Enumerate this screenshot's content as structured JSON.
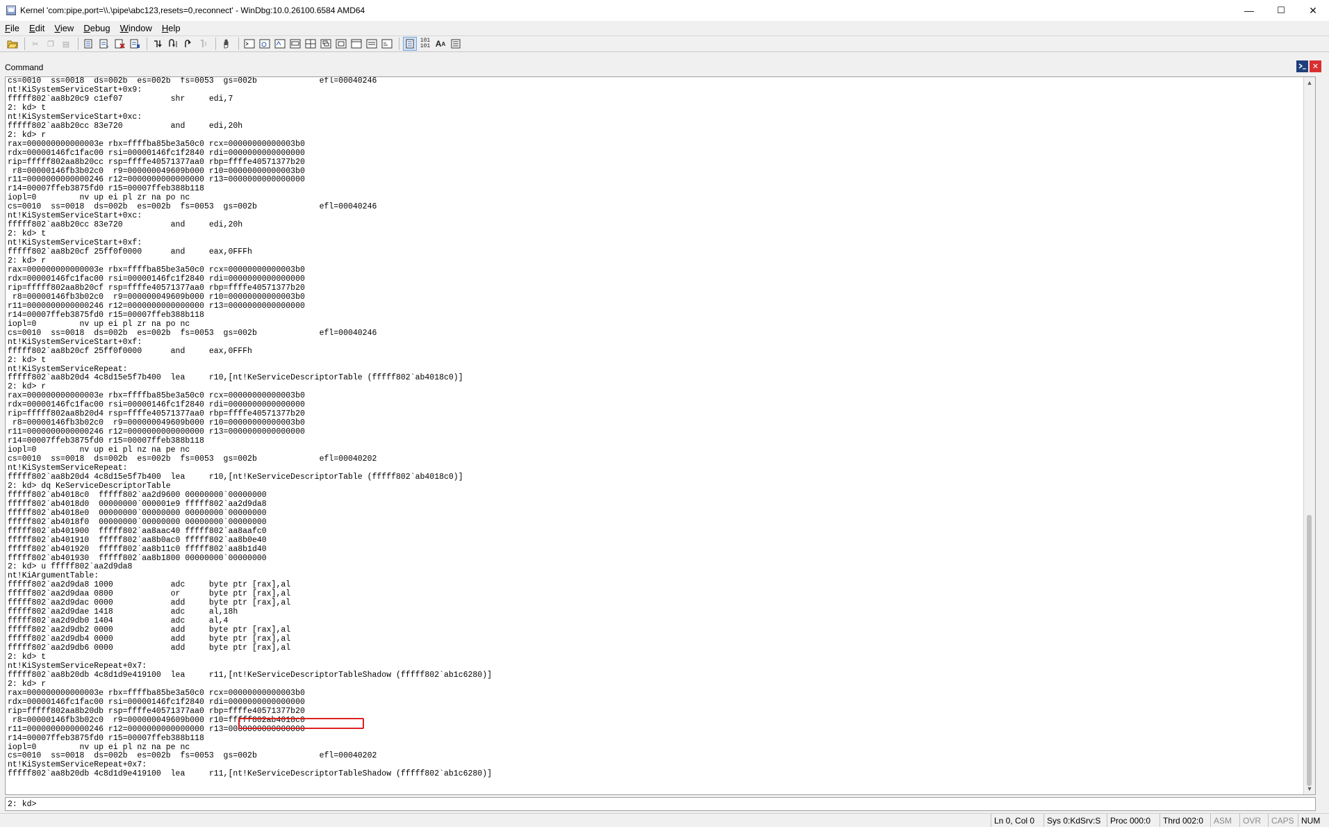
{
  "window": {
    "title": "Kernel 'com:pipe,port=\\\\.\\pipe\\abc123,resets=0,reconnect' - WinDbg:10.0.26100.6584 AMD64",
    "minimize": "—",
    "maximize": "☐",
    "close": "✕"
  },
  "menu": {
    "file": {
      "u": "F",
      "rest": "ile"
    },
    "edit": {
      "u": "E",
      "rest": "dit"
    },
    "view": {
      "u": "V",
      "rest": "iew"
    },
    "debug": {
      "u": "D",
      "rest": "ebug"
    },
    "window": {
      "u": "W",
      "rest": "indow"
    },
    "help": {
      "u": "H",
      "rest": "elp"
    }
  },
  "pane": {
    "label": "Command",
    "output_lines": [
      "cs=0010  ss=0018  ds=002b  es=002b  fs=0053  gs=002b             efl=00040246",
      "nt!KiSystemServiceStart+0x9:",
      "fffff802`aa8b20c9 c1ef07          shr     edi,7",
      "2: kd> t",
      "nt!KiSystemServiceStart+0xc:",
      "fffff802`aa8b20cc 83e720          and     edi,20h",
      "2: kd> r",
      "rax=000000000000003e rbx=ffffba85be3a50c0 rcx=00000000000003b0",
      "rdx=00000146fc1fac00 rsi=00000146fc1f2840 rdi=0000000000000000",
      "rip=fffff802aa8b20cc rsp=ffffe40571377aa0 rbp=ffffe40571377b20",
      " r8=00000146fb3b02c0  r9=000000049609b000 r10=00000000000003b0",
      "r11=0000000000000246 r12=0000000000000000 r13=0000000000000000",
      "r14=00007ffeb3875fd0 r15=00007ffeb388b118",
      "iopl=0         nv up ei pl zr na po nc",
      "cs=0010  ss=0018  ds=002b  es=002b  fs=0053  gs=002b             efl=00040246",
      "nt!KiSystemServiceStart+0xc:",
      "fffff802`aa8b20cc 83e720          and     edi,20h",
      "2: kd> t",
      "nt!KiSystemServiceStart+0xf:",
      "fffff802`aa8b20cf 25ff0f0000      and     eax,0FFFh",
      "2: kd> r",
      "rax=000000000000003e rbx=ffffba85be3a50c0 rcx=00000000000003b0",
      "rdx=00000146fc1fac00 rsi=00000146fc1f2840 rdi=0000000000000000",
      "rip=fffff802aa8b20cf rsp=ffffe40571377aa0 rbp=ffffe40571377b20",
      " r8=00000146fb3b02c0  r9=000000049609b000 r10=00000000000003b0",
      "r11=0000000000000246 r12=0000000000000000 r13=0000000000000000",
      "r14=00007ffeb3875fd0 r15=00007ffeb388b118",
      "iopl=0         nv up ei pl zr na po nc",
      "cs=0010  ss=0018  ds=002b  es=002b  fs=0053  gs=002b             efl=00040246",
      "nt!KiSystemServiceStart+0xf:",
      "fffff802`aa8b20cf 25ff0f0000      and     eax,0FFFh",
      "2: kd> t",
      "nt!KiSystemServiceRepeat:",
      "fffff802`aa8b20d4 4c8d15e5f7b400  lea     r10,[nt!KeServiceDescriptorTable (fffff802`ab4018c0)]",
      "2: kd> r",
      "rax=000000000000003e rbx=ffffba85be3a50c0 rcx=00000000000003b0",
      "rdx=00000146fc1fac00 rsi=00000146fc1f2840 rdi=0000000000000000",
      "rip=fffff802aa8b20d4 rsp=ffffe40571377aa0 rbp=ffffe40571377b20",
      " r8=00000146fb3b02c0  r9=000000049609b000 r10=00000000000003b0",
      "r11=0000000000000246 r12=0000000000000000 r13=0000000000000000",
      "r14=00007ffeb3875fd0 r15=00007ffeb388b118",
      "iopl=0         nv up ei pl nz na pe nc",
      "cs=0010  ss=0018  ds=002b  es=002b  fs=0053  gs=002b             efl=00040202",
      "nt!KiSystemServiceRepeat:",
      "fffff802`aa8b20d4 4c8d15e5f7b400  lea     r10,[nt!KeServiceDescriptorTable (fffff802`ab4018c0)]",
      "2: kd> dq KeServiceDescriptorTable",
      "fffff802`ab4018c0  fffff802`aa2d9600 00000000`00000000",
      "fffff802`ab4018d0  00000000`000001e9 fffff802`aa2d9da8",
      "fffff802`ab4018e0  00000000`00000000 00000000`00000000",
      "fffff802`ab4018f0  00000000`00000000 00000000`00000000",
      "fffff802`ab401900  fffff802`aa8aac40 fffff802`aa8aafc0",
      "fffff802`ab401910  fffff802`aa8b0ac0 fffff802`aa8b0e40",
      "fffff802`ab401920  fffff802`aa8b11c0 fffff802`aa8b1d40",
      "fffff802`ab401930  fffff802`aa8b1800 00000000`00000000",
      "2: kd> u fffff802`aa2d9da8",
      "nt!KiArgumentTable:",
      "fffff802`aa2d9da8 1000            adc     byte ptr [rax],al",
      "fffff802`aa2d9daa 0800            or      byte ptr [rax],al",
      "fffff802`aa2d9dac 0000            add     byte ptr [rax],al",
      "fffff802`aa2d9dae 1418            adc     al,18h",
      "fffff802`aa2d9db0 1404            adc     al,4",
      "fffff802`aa2d9db2 0000            add     byte ptr [rax],al",
      "fffff802`aa2d9db4 0000            add     byte ptr [rax],al",
      "fffff802`aa2d9db6 0000            add     byte ptr [rax],al",
      "2: kd> t",
      "nt!KiSystemServiceRepeat+0x7:",
      "fffff802`aa8b20db 4c8d1d9e419100  lea     r11,[nt!KeServiceDescriptorTableShadow (fffff802`ab1c6280)]",
      "2: kd> r",
      "rax=000000000000003e rbx=ffffba85be3a50c0 rcx=00000000000003b0",
      "rdx=00000146fc1fac00 rsi=00000146fc1f2840 rdi=0000000000000000",
      "rip=fffff802aa8b20db rsp=ffffe40571377aa0 rbp=ffffe40571377b20",
      " r8=00000146fb3b02c0  r9=000000049609b000 r10=fffff802ab4018c0",
      "r11=0000000000000246 r12=0000000000000000 r13=0000000000000000",
      "r14=00007ffeb3875fd0 r15=00007ffeb388b118",
      "iopl=0         nv up ei pl nz na pe nc",
      "cs=0010  ss=0018  ds=002b  es=002b  fs=0053  gs=002b             efl=00040202",
      "nt!KiSystemServiceRepeat+0x7:",
      "fffff802`aa8b20db 4c8d1d9e419100  lea     r11,[nt!KeServiceDescriptorTableShadow (fffff802`ab1c6280)]"
    ],
    "highlight_color": "#e02020",
    "prompt": "2: kd>",
    "input_value": ""
  },
  "status": {
    "ln_col": "Ln 0, Col 0",
    "sys": "Sys 0:KdSrv:S",
    "proc": "Proc 000:0",
    "thrd": "Thrd 002:0",
    "asm": "ASM",
    "ovr": "OVR",
    "caps": "CAPS",
    "num": "NUM"
  }
}
